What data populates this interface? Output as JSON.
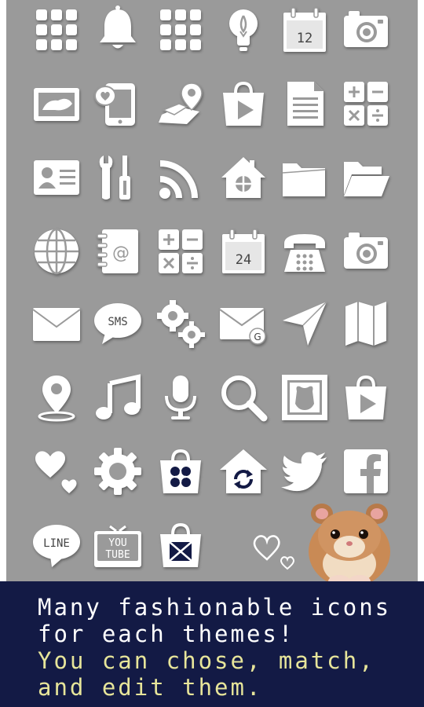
{
  "icon_grid": [
    {
      "name": "app-grid-icon"
    },
    {
      "name": "bell-icon"
    },
    {
      "name": "app-grid-icon"
    },
    {
      "name": "lightbulb-icon"
    },
    {
      "name": "calendar-icon",
      "text": "12"
    },
    {
      "name": "camera-icon"
    },
    {
      "name": "photo-icon"
    },
    {
      "name": "phone-heart-icon"
    },
    {
      "name": "map-pin-icon"
    },
    {
      "name": "play-store-bag-icon"
    },
    {
      "name": "document-icon"
    },
    {
      "name": "calculator-icon"
    },
    {
      "name": "contact-card-icon"
    },
    {
      "name": "tools-icon"
    },
    {
      "name": "rss-icon"
    },
    {
      "name": "home-icon"
    },
    {
      "name": "folder-icon"
    },
    {
      "name": "folder-open-icon"
    },
    {
      "name": "globe-icon"
    },
    {
      "name": "address-book-icon"
    },
    {
      "name": "calculator-icon"
    },
    {
      "name": "calendar-icon",
      "text": "24"
    },
    {
      "name": "telephone-icon"
    },
    {
      "name": "camera-icon"
    },
    {
      "name": "mail-icon"
    },
    {
      "name": "sms-bubble-icon",
      "text": "SMS"
    },
    {
      "name": "settings-gears-icon"
    },
    {
      "name": "gmail-icon",
      "text": "G"
    },
    {
      "name": "navigation-icon"
    },
    {
      "name": "map-icon"
    },
    {
      "name": "location-pin-icon"
    },
    {
      "name": "music-note-icon"
    },
    {
      "name": "microphone-icon"
    },
    {
      "name": "search-icon"
    },
    {
      "name": "photo-frame-icon"
    },
    {
      "name": "play-store-bag-icon"
    },
    {
      "name": "hearts-icon"
    },
    {
      "name": "settings-gear-icon"
    },
    {
      "name": "app-bag-icon"
    },
    {
      "name": "home-update-icon"
    },
    {
      "name": "twitter-icon"
    },
    {
      "name": "facebook-icon"
    },
    {
      "name": "line-bubble-icon",
      "text": "LINE"
    },
    {
      "name": "youtube-tv-icon",
      "text": "YOU\nTUBE"
    },
    {
      "name": "mail-bag-icon"
    }
  ],
  "decor": {
    "hearts": "outline-hearts-icon",
    "hamster": "hamster-photo"
  },
  "banner": {
    "line1": "Many fashionable icons",
    "line2": "for each themes!",
    "line3": "You can chose, match,",
    "line4": "and edit them."
  },
  "colors": {
    "panel": "#9a9a9a",
    "banner": "#131a45",
    "text_white": "#ffffff",
    "text_yellow": "#e7e59a"
  }
}
